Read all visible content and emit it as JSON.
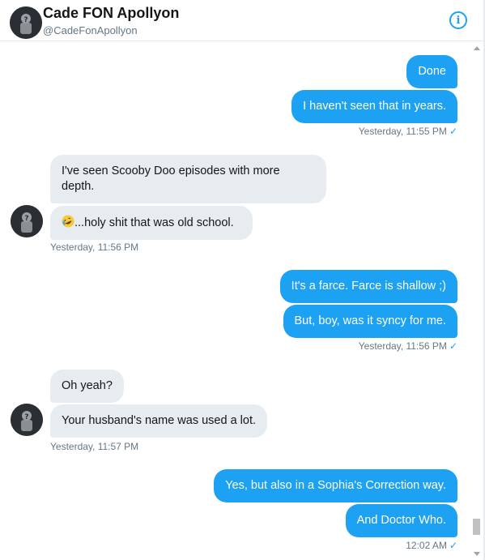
{
  "header": {
    "name": "Cade FON Apollyon",
    "handle": "@CadeFonApollyon",
    "info_icon": "i"
  },
  "messages": [
    {
      "dir": "out",
      "text": "Done"
    },
    {
      "dir": "out",
      "text": "I haven't seen that in years."
    },
    {
      "meta": "Yesterday, 11:55 PM",
      "read": true
    },
    {
      "dir": "in",
      "text": "I've seen Scooby Doo episodes with more depth."
    },
    {
      "dir": "in",
      "emoji": "rolling-on-floor-laughing",
      "text": "...holy shit that was old school."
    },
    {
      "meta": "Yesterday, 11:56 PM"
    },
    {
      "dir": "out",
      "text": "It's a farce. Farce is shallow ;)"
    },
    {
      "dir": "out",
      "text": "But, boy, was it syncy for me."
    },
    {
      "meta": "Yesterday, 11:56 PM",
      "read": true
    },
    {
      "dir": "in",
      "text": "Oh yeah?"
    },
    {
      "dir": "in",
      "text": "Your husband's name was used a lot."
    },
    {
      "meta": "Yesterday, 11:57 PM"
    },
    {
      "dir": "out",
      "text": "Yes, but also in a Sophia's Correction way."
    },
    {
      "dir": "out",
      "text": "And Doctor Who."
    },
    {
      "meta": "12:02 AM",
      "read": true
    }
  ],
  "read_check": "✓",
  "colors": {
    "accent": "#1da1f2",
    "incoming_bubble": "#e6ecf0",
    "meta_text": "#657786"
  }
}
